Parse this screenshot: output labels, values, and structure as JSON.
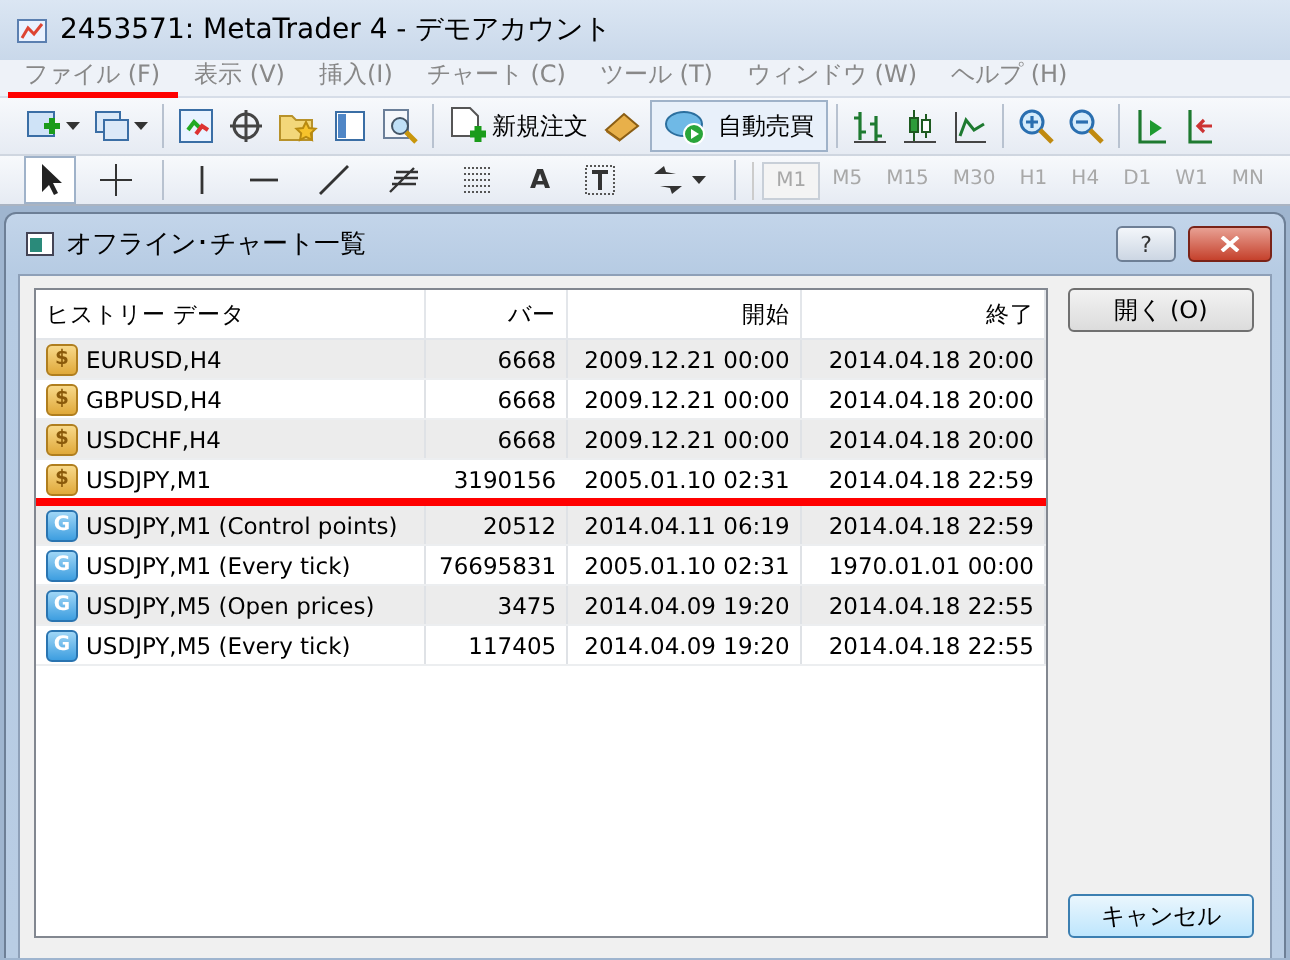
{
  "window": {
    "title": "2453571: MetaTrader 4 - デモアカウント"
  },
  "menu": [
    {
      "label": "ファイル (F)",
      "marked": true
    },
    {
      "label": "表示 (V)",
      "marked": false
    },
    {
      "label": "挿入(I)",
      "marked": false
    },
    {
      "label": "チャート (C)",
      "marked": false
    },
    {
      "label": "ツール (T)",
      "marked": false
    },
    {
      "label": "ウィンドウ (W)",
      "marked": false
    },
    {
      "label": "ヘルプ (H)",
      "marked": false
    }
  ],
  "toolbar": {
    "new_order": "新規注文",
    "auto_trading": {
      "label": "自動売買",
      "pressed": true
    }
  },
  "drawing_toolbar": {
    "text_tool": "A",
    "timeframes": [
      {
        "label": "M1",
        "disabled": true
      },
      {
        "label": "M5",
        "disabled": true
      },
      {
        "label": "M15",
        "disabled": true
      },
      {
        "label": "M30",
        "disabled": true
      },
      {
        "label": "H1",
        "disabled": true
      },
      {
        "label": "H4",
        "disabled": true
      },
      {
        "label": "D1",
        "disabled": true
      },
      {
        "label": "W1",
        "disabled": true
      },
      {
        "label": "MN",
        "disabled": true
      }
    ]
  },
  "dialog": {
    "title": "オフライン･チャート一覧",
    "help": "?",
    "table": {
      "columns": [
        "ヒストリー データ",
        "バー",
        "開始",
        "終了"
      ],
      "rows": [
        {
          "kind": "history",
          "glyph": "$",
          "name": "EURUSD,H4",
          "bars": "6668",
          "start": "2009.12.21 00:00",
          "end": "2014.04.18 20:00",
          "marked": false
        },
        {
          "kind": "history",
          "glyph": "$",
          "name": "GBPUSD,H4",
          "bars": "6668",
          "start": "2009.12.21 00:00",
          "end": "2014.04.18 20:00",
          "marked": false
        },
        {
          "kind": "history",
          "glyph": "$",
          "name": "USDCHF,H4",
          "bars": "6668",
          "start": "2009.12.21 00:00",
          "end": "2014.04.18 20:00",
          "marked": false
        },
        {
          "kind": "history",
          "glyph": "$",
          "name": "USDJPY,M1",
          "bars": "3190156",
          "start": "2005.01.10 02:31",
          "end": "2014.04.18 22:59",
          "marked": true
        },
        {
          "kind": "generated",
          "glyph": "G",
          "name": "USDJPY,M1 (Control points)",
          "bars": "20512",
          "start": "2014.04.11 06:19",
          "end": "2014.04.18 22:59",
          "marked": false
        },
        {
          "kind": "generated",
          "glyph": "G",
          "name": "USDJPY,M1 (Every tick)",
          "bars": "76695831",
          "start": "2005.01.10 02:31",
          "end": "1970.01.01 00:00",
          "marked": false
        },
        {
          "kind": "generated",
          "glyph": "G",
          "name": "USDJPY,M5 (Open prices)",
          "bars": "3475",
          "start": "2014.04.09 19:20",
          "end": "2014.04.18 22:55",
          "marked": false
        },
        {
          "kind": "generated",
          "glyph": "G",
          "name": "USDJPY,M5 (Every tick)",
          "bars": "117405",
          "start": "2014.04.09 19:20",
          "end": "2014.04.18 22:55",
          "marked": false
        }
      ]
    },
    "buttons": [
      {
        "label": "開く (O)",
        "kind": "top"
      },
      {
        "label": "キャンセル",
        "kind": "bottom"
      }
    ]
  }
}
